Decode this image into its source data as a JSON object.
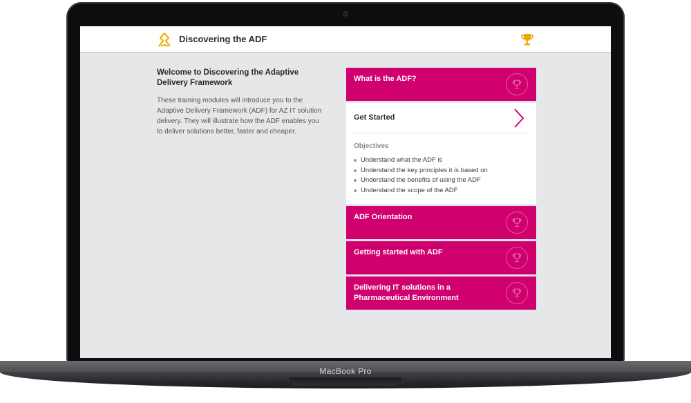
{
  "device": {
    "label": "MacBook Pro"
  },
  "header": {
    "title": "Discovering the ADF"
  },
  "intro": {
    "title": "Welcome to Discovering the Adaptive Delivery Framework",
    "body": "These training modules will introduce you to the Adaptive Delivery Framework (ADF) for AZ IT solution delivery. They will illustrate how the ADF enables you to deliver solutions better, faster and cheaper."
  },
  "modules": [
    {
      "label": "What is the ADF?"
    },
    {
      "label": "ADF Orientation"
    },
    {
      "label": "Getting started with ADF"
    },
    {
      "label": "Delivering IT solutions in a Pharmaceutical Environment"
    }
  ],
  "expanded": {
    "action_label": "Get Started",
    "objectives_title": "Objectives",
    "objectives": [
      "Understand what the ADF is",
      "Understand the key principles it is based on",
      "Understand the benefits of using the ADF",
      "Understand the scope of the ADF"
    ]
  },
  "colors": {
    "accent": "#d0006f",
    "trophy": "#f0a800",
    "logo": "#f0b000"
  },
  "icons": {
    "logo": "az-logo-icon",
    "trophy": "trophy-icon",
    "chevron": "chevron-right-icon"
  }
}
